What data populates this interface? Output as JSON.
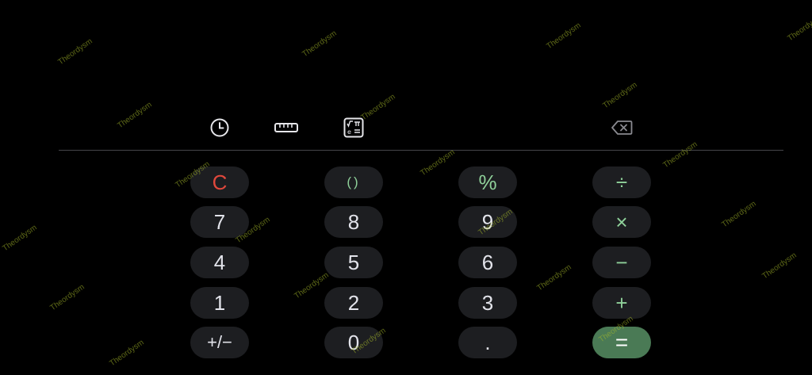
{
  "toolbar": {
    "history": "history-icon",
    "unit_converter": "ruler-icon",
    "scientific": "scientific-functions-icon",
    "backspace": "backspace-icon"
  },
  "keypad": {
    "clear": "C",
    "parentheses": "()",
    "percent": "%",
    "divide": "÷",
    "seven": "7",
    "eight": "8",
    "nine": "9",
    "multiply": "×",
    "four": "4",
    "five": "5",
    "six": "6",
    "minus": "−",
    "one": "1",
    "two": "2",
    "three": "3",
    "plus": "+",
    "sign": "+/−",
    "zero": "0",
    "decimal": ".",
    "equals": "="
  },
  "watermark": "Theordysm",
  "colors": {
    "background": "#000000",
    "key": "#1d1e21",
    "digit": "#e2e3ea",
    "operator": "#8fd19a",
    "clear": "#e0483c",
    "equals": "#4a7a55"
  }
}
